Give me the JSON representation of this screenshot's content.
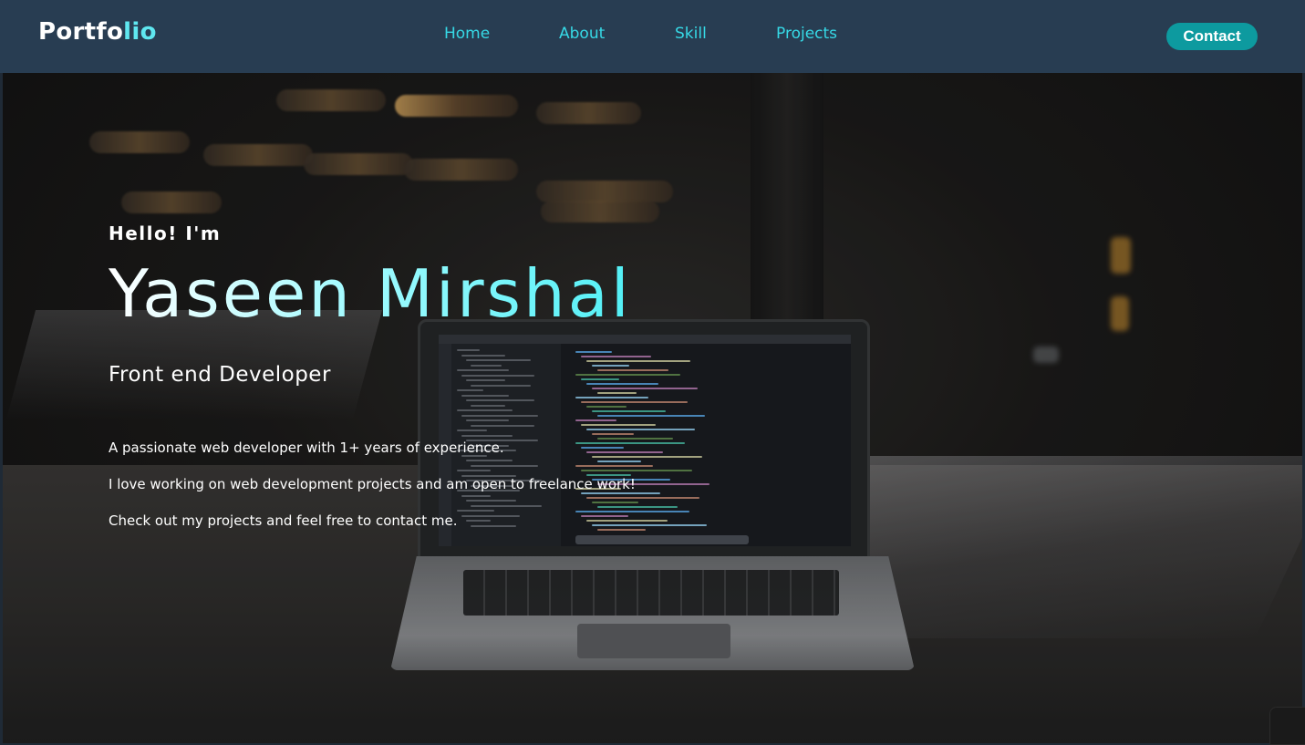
{
  "nav": {
    "logo_main": "Portfo",
    "logo_accent": "lio",
    "links": [
      "Home",
      "About",
      "Skill",
      "Projects"
    ],
    "contact_label": "Contact"
  },
  "hero": {
    "greeting": "Hello! I'm",
    "name": "Yaseen Mirshal",
    "role": "Front end Developer",
    "lines": [
      "A passionate web developer with 1+ years of experience.",
      "I love working on web development projects and am open to freelance work!",
      "Check out my projects and feel free to contact me."
    ]
  },
  "colors": {
    "navbar_bg": "#283d52",
    "accent_cyan": "#36d9e6",
    "contact_bg": "#0d9a9f"
  }
}
